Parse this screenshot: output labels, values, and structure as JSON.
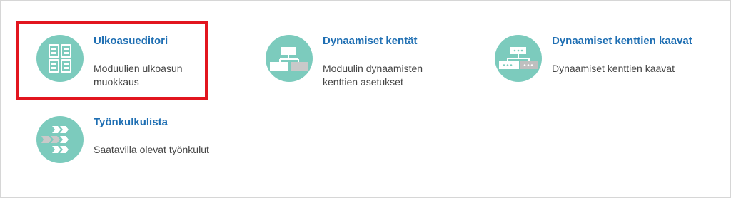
{
  "tiles": [
    {
      "title": "Ulkoasueditori",
      "description": "Moduulien ulkoasun muokkaus",
      "icon": "layout-editor-icon"
    },
    {
      "title": "Dynaamiset kentät",
      "description": "Moduulin dynaamisten kenttien asetukset",
      "icon": "dynamic-fields-icon"
    },
    {
      "title": "Dynaamiset kenttien kaavat",
      "description": "Dynaamiset kenttien kaavat",
      "icon": "field-formulas-icon"
    },
    {
      "title": "Työnkulkulista",
      "description": "Saatavilla olevat työnkulut",
      "icon": "workflow-list-icon"
    }
  ],
  "colors": {
    "icon_bg": "#7ccbbd",
    "title": "#1f6fb3",
    "highlight": "#e2151f"
  }
}
